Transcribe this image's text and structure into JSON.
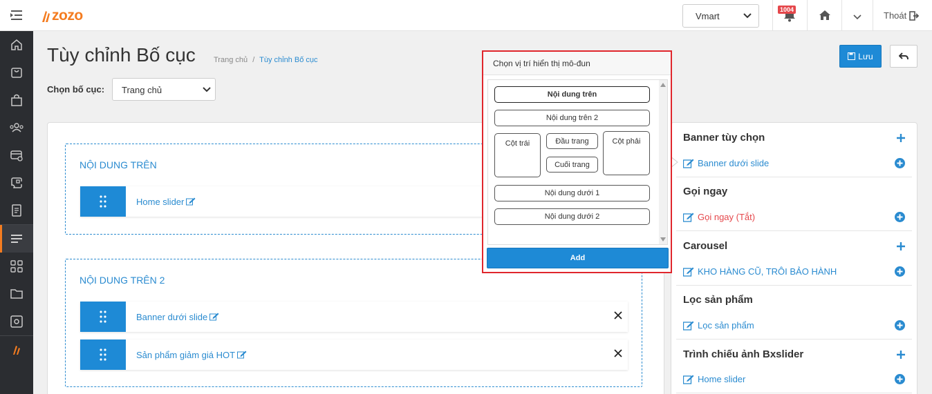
{
  "topbar": {
    "logo_text": "zozo",
    "store_select_value": "Vmart",
    "notification_count": "1004",
    "logout_label": "Thoát"
  },
  "sidebar": {
    "items": [
      {
        "icon": "home-icon"
      },
      {
        "icon": "shopping-bag-icon"
      },
      {
        "icon": "bag-icon"
      },
      {
        "icon": "users-icon"
      },
      {
        "icon": "payment-icon"
      },
      {
        "icon": "cast-icon"
      },
      {
        "icon": "document-icon"
      },
      {
        "icon": "layout-lines-icon",
        "active": true
      },
      {
        "icon": "grid-icon"
      },
      {
        "icon": "folder-icon"
      },
      {
        "icon": "settings-icon"
      },
      {
        "icon": "brand-icon"
      }
    ]
  },
  "header": {
    "title": "Tùy chỉnh Bố cục",
    "breadcrumb": [
      "Trang chủ",
      "Tùy chỉnh Bố cục"
    ],
    "breadcrumb_sep": "/",
    "layout_label": "Chọn bố cục:",
    "layout_value": "Trang chủ",
    "save_label": "Lưu"
  },
  "sections": [
    {
      "title": "NỘI DUNG TRÊN",
      "modules": [
        {
          "name": "Home slider"
        }
      ]
    },
    {
      "title": "NỘI DUNG TRÊN 2",
      "modules": [
        {
          "name": "Banner dưới slide"
        },
        {
          "name": "Sản phẩm giảm giá HOT"
        }
      ]
    }
  ],
  "right_panel": {
    "groups": [
      {
        "title": "Banner tùy chọn",
        "items": [
          {
            "name": "Banner dưới slide",
            "color": "#2a8bd0"
          }
        ]
      },
      {
        "title": "Gọi ngay",
        "items": [
          {
            "name": "Gọi ngay (Tắt)",
            "color": "#e5474b"
          }
        ]
      },
      {
        "title": "Carousel",
        "items": [
          {
            "name": "KHO HÀNG CŨ, TRÔI BẢO HÀNH",
            "color": "#2a8bd0"
          }
        ]
      },
      {
        "title": "Lọc sản phẩm",
        "items": [
          {
            "name": "Lọc sản phẩm",
            "color": "#2a8bd0"
          }
        ]
      },
      {
        "title": "Trình chiếu ảnh Bxslider",
        "items": [
          {
            "name": "Home slider",
            "color": "#2a8bd0"
          }
        ]
      }
    ]
  },
  "popover": {
    "title": "Chọn vị trí hiển thị mô-đun",
    "positions": {
      "top": "Nội dung trên",
      "top2": "Nội dung trên 2",
      "left_col": "Cột trái",
      "header": "Đầu trang",
      "footer": "Cuối trang",
      "right_col": "Cột phải",
      "bottom1": "Nội dung dưới 1",
      "bottom2": "Nội dung dưới 2"
    },
    "selected": "Nội dung trên",
    "add_label": "Add"
  },
  "colors": {
    "accent": "#1e8ad6",
    "link": "#2a8bd0",
    "brand": "#f47c20",
    "danger": "#e5474b",
    "sidebar_bg": "#2b2d31"
  }
}
